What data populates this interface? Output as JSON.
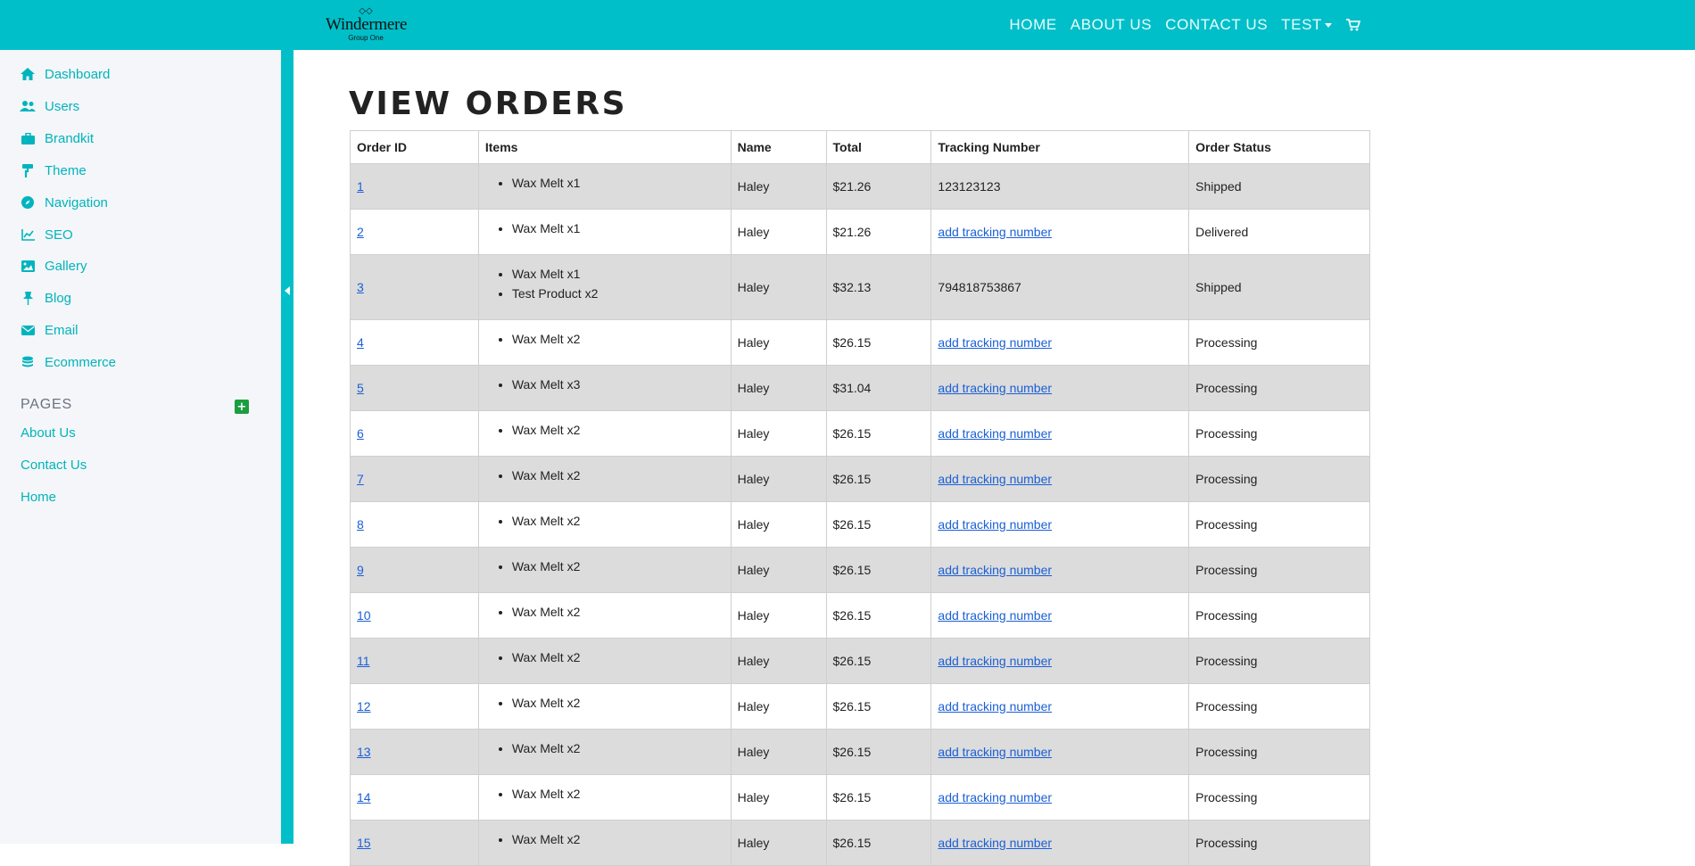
{
  "brand": {
    "name": "Windermere",
    "sub": "Group One",
    "mark": "◇◇"
  },
  "nav": {
    "home": "HOME",
    "about": "ABOUT US",
    "contact": "CONTACT US",
    "test": "TEST"
  },
  "sidebar": {
    "items": [
      {
        "label": "Dashboard",
        "icon": "home-icon"
      },
      {
        "label": "Users",
        "icon": "users-icon"
      },
      {
        "label": "Brandkit",
        "icon": "briefcase-icon"
      },
      {
        "label": "Theme",
        "icon": "paint-roller-icon"
      },
      {
        "label": "Navigation",
        "icon": "compass-icon"
      },
      {
        "label": "SEO",
        "icon": "line-chart-icon"
      },
      {
        "label": "Gallery",
        "icon": "image-icon"
      },
      {
        "label": "Blog",
        "icon": "thumbtack-icon"
      },
      {
        "label": "Email",
        "icon": "envelope-icon"
      },
      {
        "label": "Ecommerce",
        "icon": "coins-icon"
      }
    ],
    "pages_heading": "PAGES",
    "add_page": "+",
    "pages": [
      "About Us",
      "Contact Us",
      "Home"
    ]
  },
  "main": {
    "title": "VIEW ORDERS",
    "columns": [
      "Order ID",
      "Items",
      "Name",
      "Total",
      "Tracking Number",
      "Order Status"
    ],
    "orders": [
      {
        "id": "1",
        "items": [
          "Wax Melt x1"
        ],
        "name": "Haley",
        "total": "$21.26",
        "tracking": "123123123",
        "status": "Shipped"
      },
      {
        "id": "2",
        "items": [
          "Wax Melt x1"
        ],
        "name": "Haley",
        "total": "$21.26",
        "tracking": "add tracking number",
        "status": "Delivered"
      },
      {
        "id": "3",
        "items": [
          "Wax Melt x1",
          "Test Product x2"
        ],
        "name": "Haley",
        "total": "$32.13",
        "tracking": "794818753867",
        "status": "Shipped"
      },
      {
        "id": "4",
        "items": [
          "Wax Melt x2"
        ],
        "name": "Haley",
        "total": "$26.15",
        "tracking": "add tracking number",
        "status": "Processing"
      },
      {
        "id": "5",
        "items": [
          "Wax Melt x3"
        ],
        "name": "Haley",
        "total": "$31.04",
        "tracking": "add tracking number",
        "status": "Processing"
      },
      {
        "id": "6",
        "items": [
          "Wax Melt x2"
        ],
        "name": "Haley",
        "total": "$26.15",
        "tracking": "add tracking number",
        "status": "Processing"
      },
      {
        "id": "7",
        "items": [
          "Wax Melt x2"
        ],
        "name": "Haley",
        "total": "$26.15",
        "tracking": "add tracking number",
        "status": "Processing"
      },
      {
        "id": "8",
        "items": [
          "Wax Melt x2"
        ],
        "name": "Haley",
        "total": "$26.15",
        "tracking": "add tracking number",
        "status": "Processing"
      },
      {
        "id": "9",
        "items": [
          "Wax Melt x2"
        ],
        "name": "Haley",
        "total": "$26.15",
        "tracking": "add tracking number",
        "status": "Processing"
      },
      {
        "id": "10",
        "items": [
          "Wax Melt x2"
        ],
        "name": "Haley",
        "total": "$26.15",
        "tracking": "add tracking number",
        "status": "Processing"
      },
      {
        "id": "11",
        "items": [
          "Wax Melt x2"
        ],
        "name": "Haley",
        "total": "$26.15",
        "tracking": "add tracking number",
        "status": "Processing"
      },
      {
        "id": "12",
        "items": [
          "Wax Melt x2"
        ],
        "name": "Haley",
        "total": "$26.15",
        "tracking": "add tracking number",
        "status": "Processing"
      },
      {
        "id": "13",
        "items": [
          "Wax Melt x2"
        ],
        "name": "Haley",
        "total": "$26.15",
        "tracking": "add tracking number",
        "status": "Processing"
      },
      {
        "id": "14",
        "items": [
          "Wax Melt x2"
        ],
        "name": "Haley",
        "total": "$26.15",
        "tracking": "add tracking number",
        "status": "Processing"
      },
      {
        "id": "15",
        "items": [
          "Wax Melt x2"
        ],
        "name": "Haley",
        "total": "$26.15",
        "tracking": "add tracking number",
        "status": "Processing"
      }
    ]
  },
  "colors": {
    "accent": "#00bfc9",
    "link": "#1a5fd6",
    "row_alt": "#dcdcdc",
    "add_green": "#1a9e3f"
  }
}
